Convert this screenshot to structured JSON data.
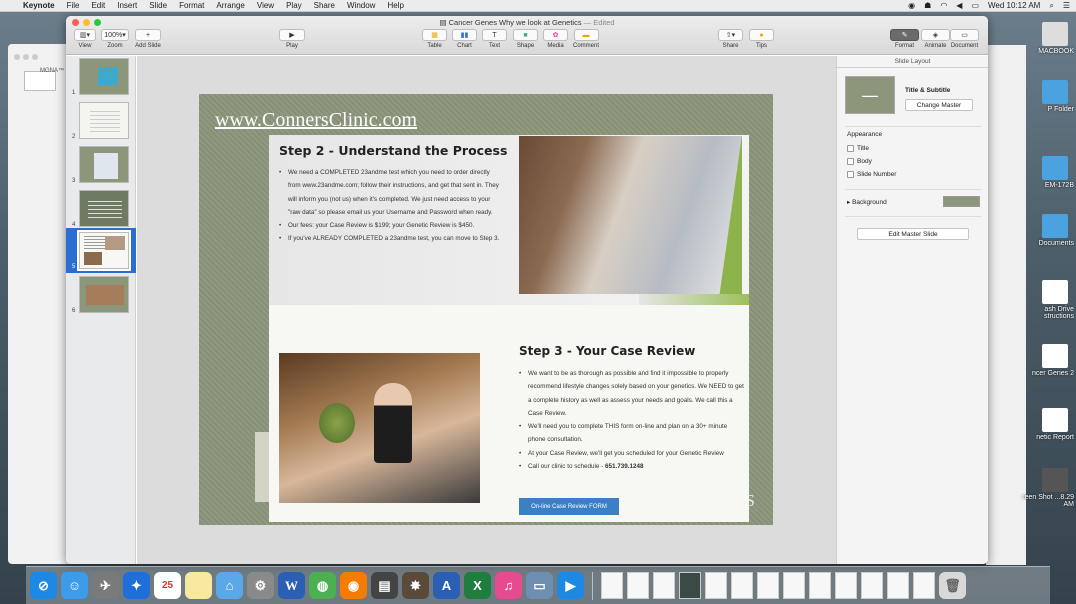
{
  "menubar": {
    "app": "Keynote",
    "items": [
      "File",
      "Edit",
      "Insert",
      "Slide",
      "Format",
      "Arrange",
      "View",
      "Play",
      "Share",
      "Window",
      "Help"
    ],
    "clock": "Wed 10:12 AM"
  },
  "window": {
    "title": "Cancer Genes Why we look at Genetics",
    "edited": "— Edited"
  },
  "toolbar": {
    "view": "View",
    "zoom_value": "100%",
    "zoom": "Zoom",
    "add_slide": "Add Slide",
    "play": "Play",
    "table": "Table",
    "chart": "Chart",
    "text": "Text",
    "shape": "Shape",
    "media": "Media",
    "comment": "Comment",
    "share": "Share",
    "tips": "Tips",
    "format": "Format",
    "animate": "Animate",
    "document": "Document"
  },
  "navigator": {
    "slides": [
      "1",
      "2",
      "3",
      "4",
      "5",
      "6"
    ],
    "selected": "5"
  },
  "background_window": {
    "label": "MGNA™"
  },
  "slide": {
    "url": "www.ConnersClinic.com",
    "step2_title": "Step 2 - Understand the Process",
    "step2_bullets": [
      "We need a COMPLETED 23andme test which you need to order directly from www.23andme.com; follow their instructions, and get that sent in. They will inform you (not us) when it's completed. We just need access to your \"raw data\" so please email us your Username and Password when ready.",
      "Our fees: your Case Review is $199; your Genetic Review is $450.",
      "If you've ALREADY COMPLETED a 23andme test, you can move to Step 3."
    ],
    "step3_title": "Step 3 - Your Case Review",
    "step3_bullets": [
      "We want to be as thorough as possible and find it impossible to properly recommend lifestyle changes solely based on your genetics. We NEED to get a complete history as well as assess your needs and goals. We call this a Case Review.",
      "We'll need you to complete THIS form on-line and plan on a 30+ minute phone consultation.",
      "At your Case Review, we'll get you scheduled for your Genetic Review"
    ],
    "call_text": "Call our clinic to schedule - ",
    "phone": "651.739.1248",
    "form_button": "On-line Case Review FORM",
    "fragment_right": "TS"
  },
  "inspector": {
    "header": "Slide Layout",
    "layout_name": "Title & Subtitle",
    "change_master": "Change Master",
    "appearance": "Appearance",
    "options": [
      "Title",
      "Body",
      "Slide Number"
    ],
    "background": "Background",
    "edit_master": "Edit Master Slide",
    "background_color": "#8b967b"
  },
  "desktop": {
    "items": [
      "MACBOOK",
      "P Folder",
      "EM-172B",
      "Documents",
      "ash Drive structions",
      "DOCX",
      "ncer Genes 2",
      "DOCX",
      "netic Report",
      "reen Shot ...8.29 AM"
    ]
  },
  "dock": {
    "calendar_day": "25"
  }
}
